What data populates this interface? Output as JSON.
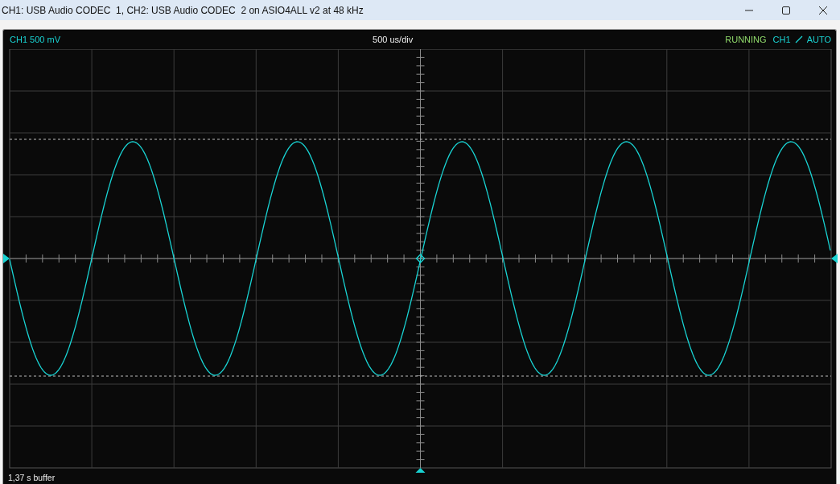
{
  "window": {
    "title": "CH1: USB Audio CODEC  1, CH2: USB Audio CODEC  2 on ASIO4ALL v2 at 48 kHz"
  },
  "scope": {
    "channel_scale": "CH1 500 mV",
    "timebase": "500 us/div",
    "status": "RUNNING",
    "trigger_channel": "CH1",
    "trigger_mode": "AUTO",
    "buffer": "1,37 s buffer"
  }
}
